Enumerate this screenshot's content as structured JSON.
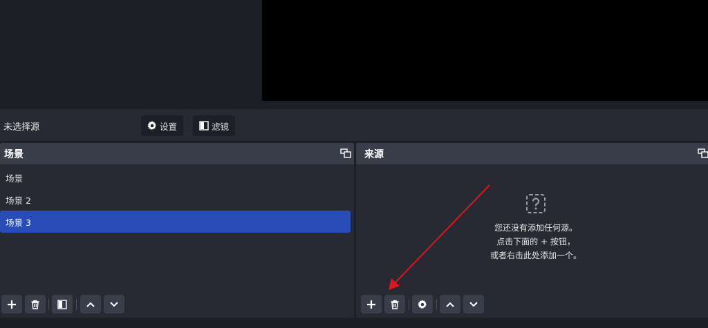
{
  "source_toolbar": {
    "no_selection": "未选择源",
    "settings_label": "设置",
    "filters_label": "滤镜"
  },
  "scenes": {
    "title": "场景",
    "items": [
      {
        "label": "场景"
      },
      {
        "label": "场景 2"
      },
      {
        "label": "场景 3",
        "selected": true
      }
    ]
  },
  "sources": {
    "title": "来源",
    "empty_lines": [
      "您还没有添加任何源。",
      "点击下面的 + 按钮，",
      "或者右击此处添加一个。"
    ]
  },
  "colors": {
    "selected": "#284cb8",
    "annotation_arrow": "#e0141e"
  }
}
